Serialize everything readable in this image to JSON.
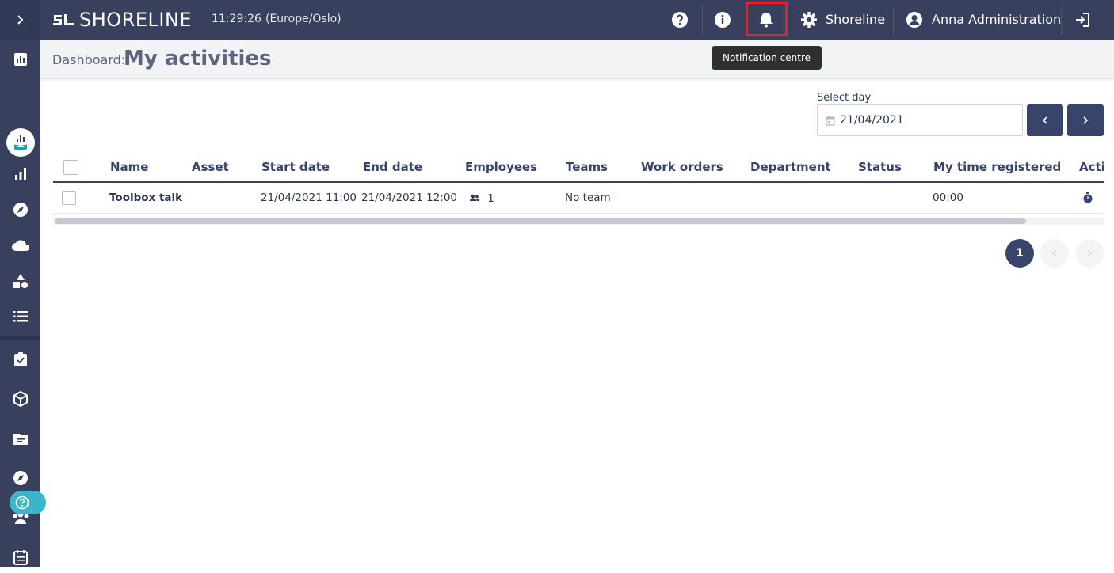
{
  "app": {
    "logo_text": "SHORELINE",
    "clock": "11:29:26",
    "timezone": "(Europe/Oslo)"
  },
  "topbar": {
    "company_label": "Shoreline",
    "user_label": "Anna Administration",
    "icons": [
      "help-icon",
      "info-icon",
      "bell-icon",
      "gear-icon",
      "user-icon",
      "logout-icon"
    ],
    "highlight_color": "#e8202a"
  },
  "tooltip": {
    "text": "Notification centre"
  },
  "sidebar": {
    "icons": [
      "chart-icon",
      "calendar-person-icon",
      "chart-icon",
      "bar-chart-icon",
      "compass-icon",
      "cloud-icon",
      "shapes-icon",
      "list-icon",
      "clipboard-check-icon",
      "box-icon",
      "folder-icon",
      "compass-icon",
      "people-icon",
      "calendar-list-icon"
    ],
    "active_index": 1,
    "help_icon": "question-circle-icon"
  },
  "header": {
    "breadcrumb": "Dashboard:",
    "title": "My activities"
  },
  "day_selector": {
    "label": "Select day",
    "value": "21/04/2021",
    "prev_label": "‹",
    "next_label": "›"
  },
  "table": {
    "columns": [
      "Name",
      "Asset",
      "Start date",
      "End date",
      "Employees",
      "Teams",
      "Work orders",
      "Department",
      "Status",
      "My time registered",
      "Actio"
    ],
    "rows": [
      {
        "name": "Toolbox talk",
        "asset": "",
        "start": "21/04/2021 11:00",
        "end": "21/04/2021 12:00",
        "employees": "1",
        "teams": "No team",
        "work_orders": "",
        "department": "",
        "status": "",
        "time": "00:00",
        "action_icon": "stopwatch-icon"
      }
    ]
  },
  "pagination": {
    "current": "1",
    "prev": "‹",
    "next": "›"
  },
  "colors": {
    "primary": "#38405e",
    "accent": "#38456b",
    "help": "#3ab6c8"
  }
}
